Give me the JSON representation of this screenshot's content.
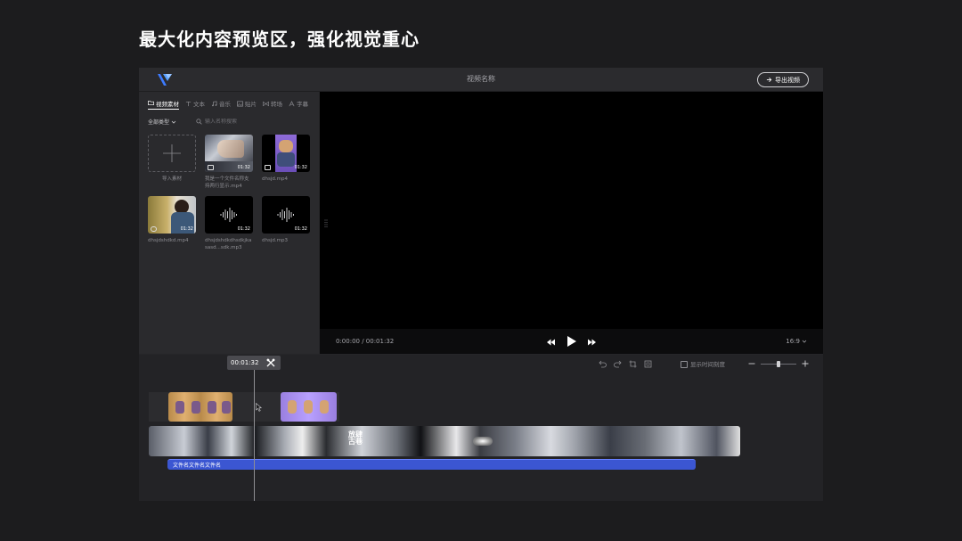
{
  "page_heading": "最大化内容预览区，强化视觉重心",
  "window": {
    "title": "视频名称",
    "export_label": "导出视频"
  },
  "tabs": [
    {
      "label": "视频素材",
      "icon": "folder-icon",
      "active": true
    },
    {
      "label": "文本",
      "icon": "text-icon"
    },
    {
      "label": "音乐",
      "icon": "music-icon"
    },
    {
      "label": "贴片",
      "icon": "image-icon"
    },
    {
      "label": "转场",
      "icon": "transition-icon"
    },
    {
      "label": "字幕",
      "icon": "subtitle-icon"
    }
  ],
  "filter": {
    "label": "全部类型",
    "search_placeholder": "输入名称搜索"
  },
  "media": [
    {
      "label": "导入素材",
      "type": "import"
    },
    {
      "label": "我是一个文件名称支持两行显示.mp4",
      "duration": "01:32",
      "type": "video"
    },
    {
      "label": "dhsjd.mp4",
      "duration": "01:32",
      "type": "video"
    },
    {
      "label": "dhsjdshdkd.mp4",
      "duration": "01:32",
      "type": "video"
    },
    {
      "label": "dhsjdshdkdhsdkjkasasd...sdk.mp3",
      "duration": "01:32",
      "type": "audio"
    },
    {
      "label": "dhsjd.mp3",
      "duration": "01:32",
      "type": "audio"
    }
  ],
  "player": {
    "timecode": "0:00:00 / 00:01:32",
    "aspect": "16:9"
  },
  "timeline": {
    "playhead_time": "00:01:32",
    "show_scale_label": "显示时间刻度",
    "zoom_level": 0.5,
    "audio_clip_label": "文件名文件名文件名"
  },
  "colors": {
    "accent": "#3b56d2",
    "preview_bg": "#000000",
    "panel_bg": "#2a2a2d"
  }
}
